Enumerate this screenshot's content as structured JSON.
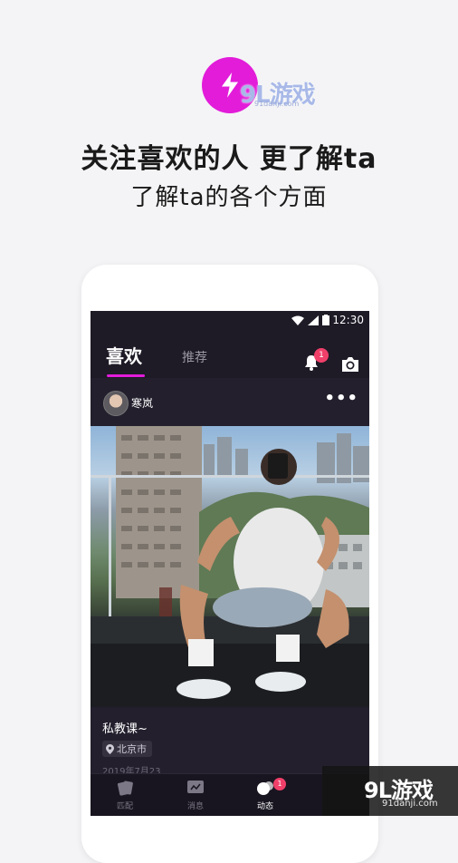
{
  "promo": {
    "headline": "关注喜欢的人 更了解ta",
    "subline": "了解ta的各个方面"
  },
  "watermark": {
    "brand": "9L游戏",
    "domain_top": "91danji.com",
    "domain_bottom": "91danji.com"
  },
  "status_bar": {
    "time": "12:30"
  },
  "header": {
    "tab_active": "喜欢",
    "tab_inactive": "推荐",
    "notification_count": "1"
  },
  "post": {
    "username": "寒岚",
    "more": "•••",
    "caption": "私教课~",
    "location": "北京市",
    "date": "2019年7月23"
  },
  "tabbar": {
    "items": [
      {
        "label": "匹配",
        "icon": "cards-icon"
      },
      {
        "label": "消息",
        "icon": "message-icon"
      },
      {
        "label": "动态",
        "icon": "moments-icon"
      }
    ],
    "active_badge": "1"
  },
  "colors": {
    "accent": "#e21cd9",
    "badge": "#f0406a",
    "screen_bg": "#1e1a26"
  }
}
